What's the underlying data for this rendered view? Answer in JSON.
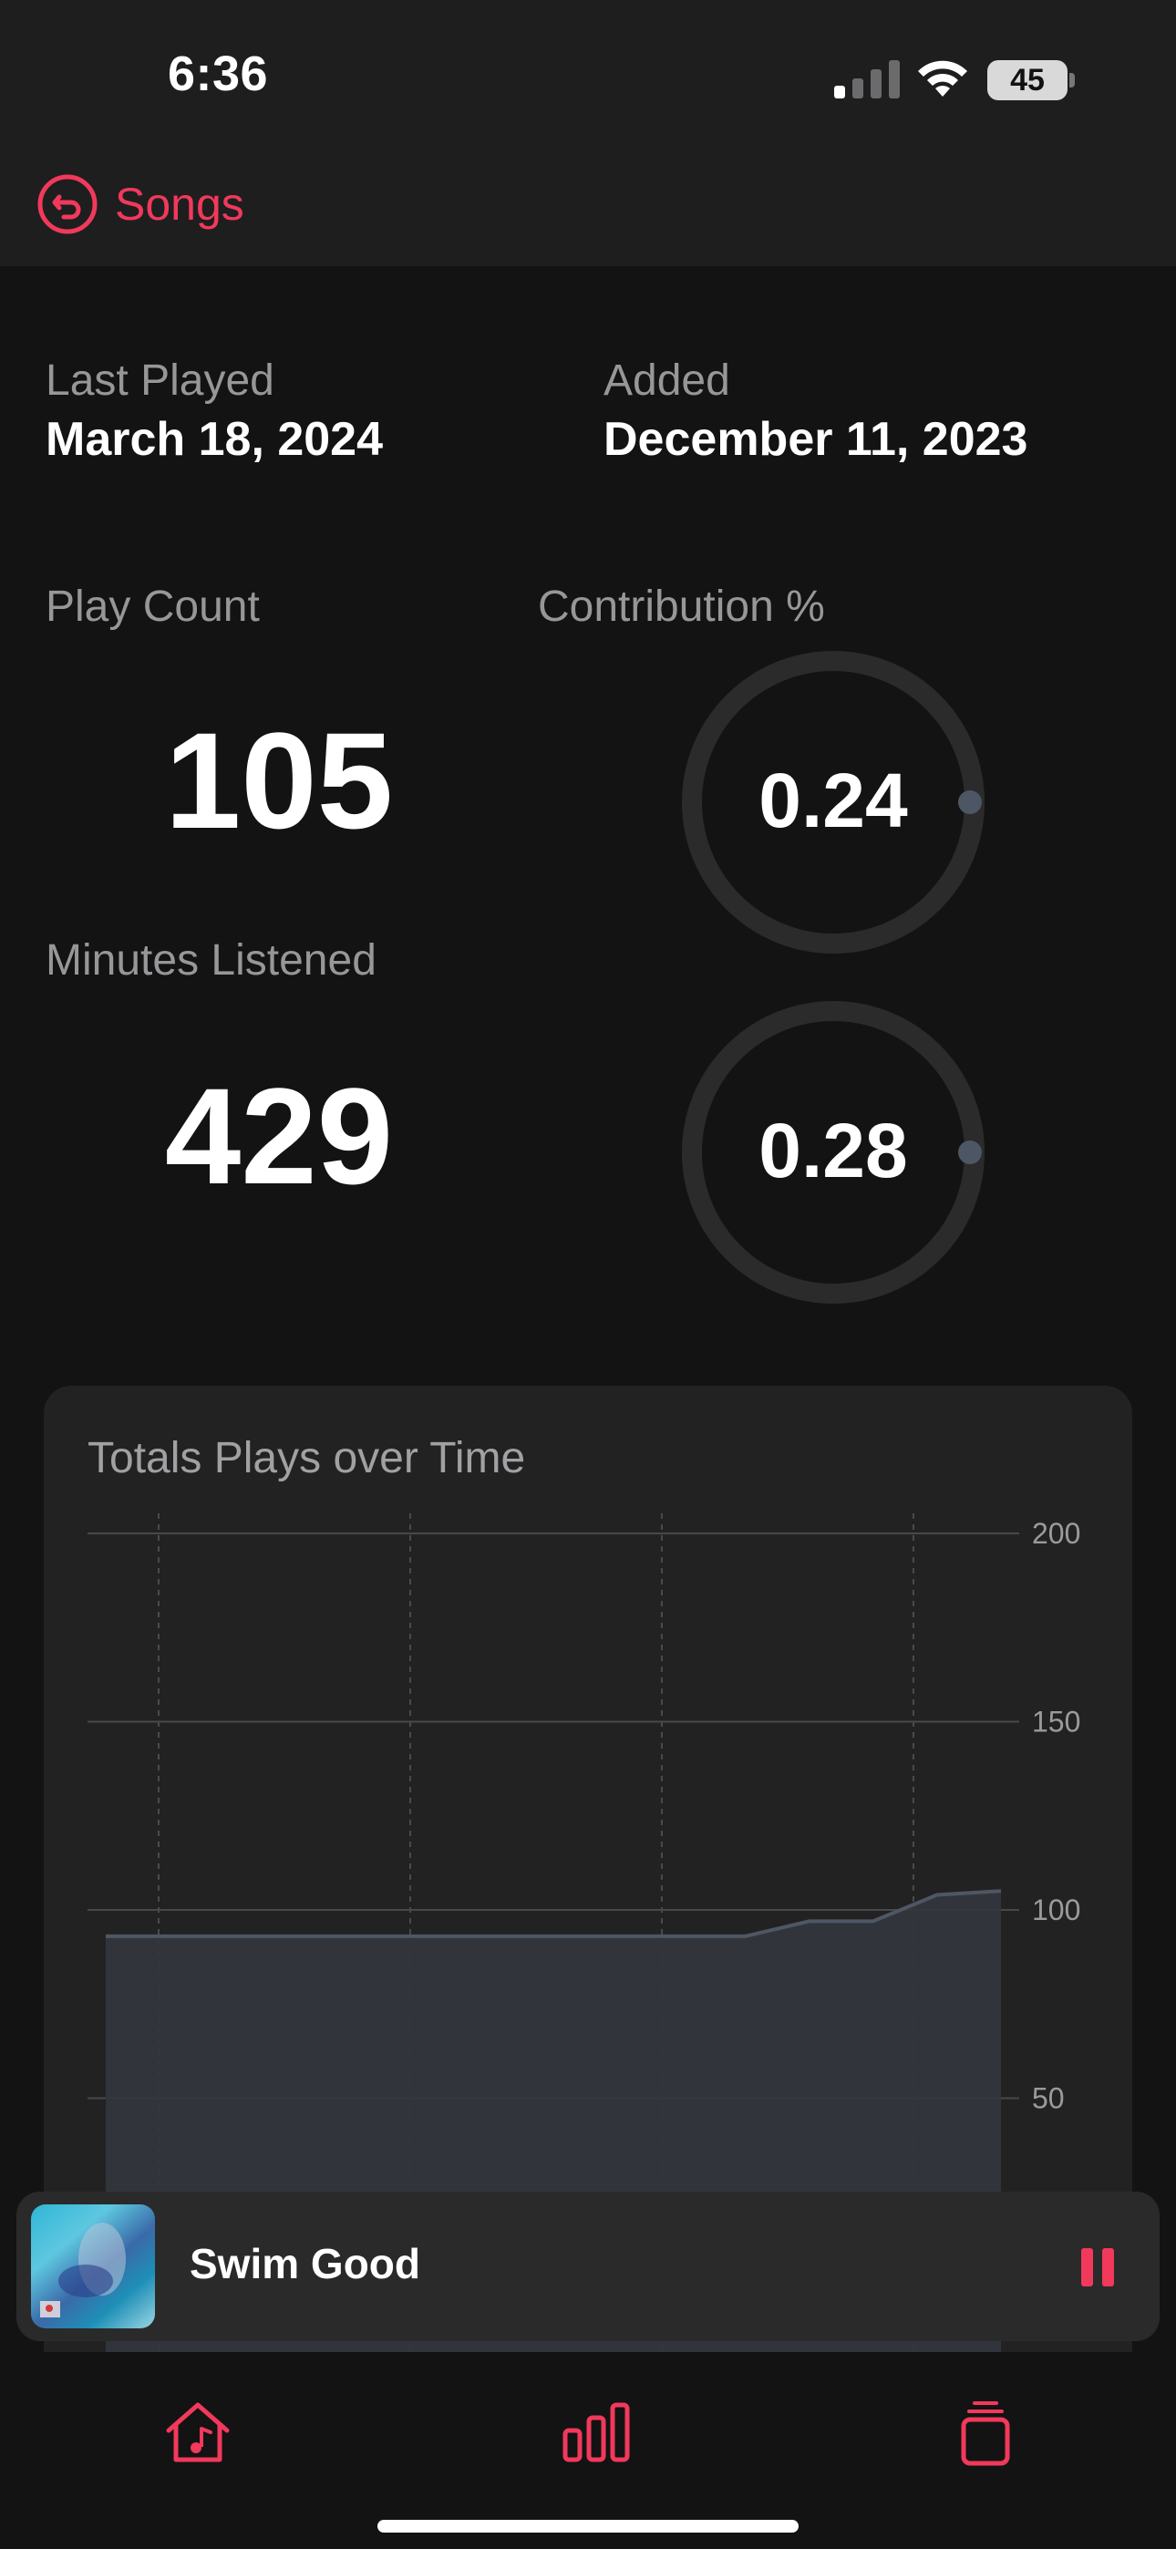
{
  "status_bar": {
    "time": "6:36",
    "battery": "45"
  },
  "nav": {
    "back_label": "Songs"
  },
  "details": {
    "last_played_label": "Last Played",
    "last_played_value": "March 18, 2024",
    "added_label": "Added",
    "added_value": "December 11, 2023"
  },
  "stats": {
    "play_count_label": "Play Count",
    "play_count_value": "105",
    "contribution_label": "Contribution %",
    "contribution_play_value": "0.24",
    "minutes_label": "Minutes Listened",
    "minutes_value": "429",
    "contribution_minutes_value": "0.28"
  },
  "chart_data": {
    "type": "area",
    "title": "Totals Plays over Time",
    "ylim": [
      0,
      200
    ],
    "y_ticks": [
      200,
      150,
      100,
      50
    ],
    "grid": true,
    "series": [
      {
        "values": [
          93,
          93,
          93,
          93,
          93,
          93,
          93,
          93,
          93,
          93,
          93,
          97,
          97,
          104,
          105
        ]
      }
    ],
    "color": "#4a525d"
  },
  "now_playing": {
    "title": "Swim Good"
  },
  "tabs": [
    {
      "icon": "home-music-icon"
    },
    {
      "icon": "chart-bars-icon"
    },
    {
      "icon": "stack-icon"
    }
  ],
  "colors": {
    "accent": "#f1395b",
    "background": "#131313",
    "card": "#222223"
  }
}
